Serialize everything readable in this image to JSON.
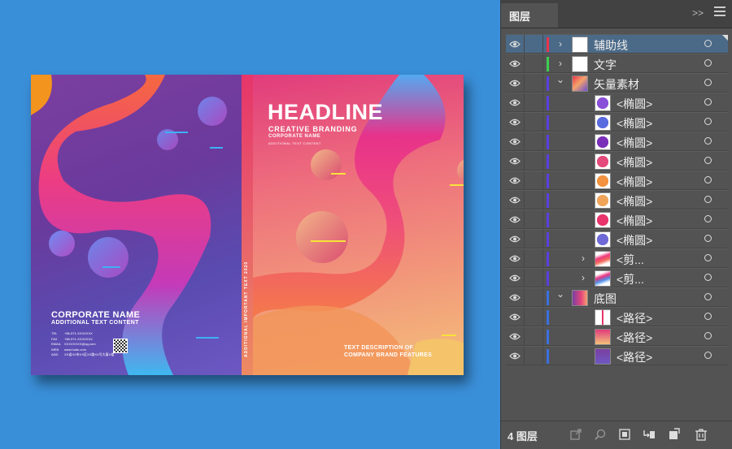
{
  "cover": {
    "headline": "HEADLINE",
    "creative_branding": "CREATIVE BRANDING",
    "corporate_name_small": "CORPORATE NAME",
    "additional_small": "ADDITIONAL TEXT CONTENT",
    "back_company": "CORPORATE NAME",
    "back_sub": "ADDITIONAL TEXT CONTENT",
    "contact": [
      {
        "k": "TEL",
        "v": "+86-571-XXXXXXX"
      },
      {
        "k": "FAX",
        "v": "+86-571-XXXXXXX"
      },
      {
        "k": "EMAIL",
        "v": "XXXXXXXX@qq.com"
      },
      {
        "k": "WEB",
        "v": "www.huitu.com"
      },
      {
        "k": "ADD",
        "v": "XX省XX市XX区XX路XX号大厦X楼"
      }
    ],
    "spine_text": "ADDITIONAL IMPORTANT TEXT 2020",
    "text_desc_1": "TEXT DESCRIPTION OF",
    "text_desc_2": "COMPANY BRAND FEATURES"
  },
  "panel": {
    "tab_label": "图层",
    "collapse_label": ">>",
    "layer_count": "4 图层",
    "layers": [
      {
        "name": "辅助线",
        "level": 0,
        "expand": "collapsed",
        "color": "#e8344b",
        "selected": true,
        "thumb": "white"
      },
      {
        "name": "文字",
        "level": 0,
        "expand": "collapsed",
        "color": "#3ccf4f",
        "selected": false,
        "thumb": "white"
      },
      {
        "name": "矢量素材",
        "level": 0,
        "expand": "expanded",
        "color": "#5b3fe0",
        "selected": false,
        "thumb": "mix"
      },
      {
        "name": "<椭圆>",
        "level": 1,
        "expand": "none",
        "color": "#5b3fe0",
        "selected": false,
        "thumb": "c1"
      },
      {
        "name": "<椭圆>",
        "level": 1,
        "expand": "none",
        "color": "#5b3fe0",
        "selected": false,
        "thumb": "c2"
      },
      {
        "name": "<椭圆>",
        "level": 1,
        "expand": "none",
        "color": "#5b3fe0",
        "selected": false,
        "thumb": "c3"
      },
      {
        "name": "<椭圆>",
        "level": 1,
        "expand": "none",
        "color": "#5b3fe0",
        "selected": false,
        "thumb": "c4"
      },
      {
        "name": "<椭圆>",
        "level": 1,
        "expand": "none",
        "color": "#5b3fe0",
        "selected": false,
        "thumb": "c5"
      },
      {
        "name": "<椭圆>",
        "level": 1,
        "expand": "none",
        "color": "#5b3fe0",
        "selected": false,
        "thumb": "c6"
      },
      {
        "name": "<椭圆>",
        "level": 1,
        "expand": "none",
        "color": "#5b3fe0",
        "selected": false,
        "thumb": "c7"
      },
      {
        "name": "<椭圆>",
        "level": 1,
        "expand": "none",
        "color": "#5b3fe0",
        "selected": false,
        "thumb": "c8"
      },
      {
        "name": "<剪...",
        "level": 1,
        "expand": "collapsed",
        "color": "#5b3fe0",
        "selected": false,
        "thumb": "s1"
      },
      {
        "name": "<剪...",
        "level": 1,
        "expand": "collapsed",
        "color": "#5b3fe0",
        "selected": false,
        "thumb": "s2"
      },
      {
        "name": "底图",
        "level": 0,
        "expand": "expanded",
        "color": "#3b6fe0",
        "selected": false,
        "thumb": "bg"
      },
      {
        "name": "<路径>",
        "level": 1,
        "expand": "none",
        "color": "#3b6fe0",
        "selected": false,
        "thumb": "p1"
      },
      {
        "name": "<路径>",
        "level": 1,
        "expand": "none",
        "color": "#3b6fe0",
        "selected": false,
        "thumb": "p2"
      },
      {
        "name": "<路径>",
        "level": 1,
        "expand": "none",
        "color": "#3b6fe0",
        "selected": false,
        "thumb": "p3"
      }
    ],
    "footer_icons": [
      "export-icon",
      "locate-object-icon",
      "clipping-mask-icon",
      "new-sublayer-icon",
      "new-layer-icon",
      "trash-icon"
    ]
  }
}
